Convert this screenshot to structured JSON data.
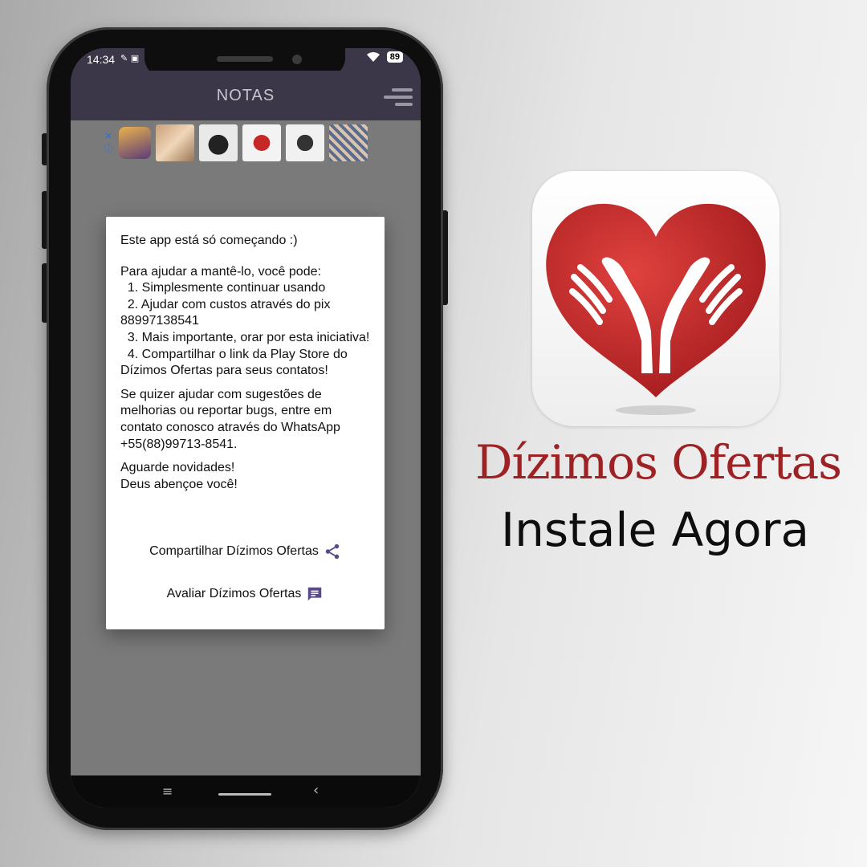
{
  "status_bar": {
    "time": "14:34",
    "battery": "89"
  },
  "app_bar": {
    "title": "NOTAS"
  },
  "dialog": {
    "heading": "Este app está só começando :)",
    "intro": "Para ajudar a mantê-lo, você pode:",
    "item1": "  1. Simplesmente continuar usando",
    "item2": "  2. Ajudar com custos através do pix 88997138541",
    "item3": "  3. Mais importante, orar por esta iniciativa!",
    "item4": "  4. Compartilhar o link da Play Store do Dízimos Ofertas para seus contatos!",
    "suggestions": "Se quizer ajudar com sugestões de melhorias ou reportar bugs, entre em contato conosco através do WhatsApp +55(88)99713-8541.",
    "closing1": "Aguarde novidades!",
    "closing2": "Deus abençoe você!",
    "share_label": "Compartilhar Dízimos Ofertas",
    "rate_label": "Avaliar Dízimos Ofertas",
    "accent": "#5a4a8a"
  },
  "promo": {
    "brand": "Dízimos Ofertas",
    "tagline": "Instale Agora",
    "brand_color": "#9e2123"
  }
}
